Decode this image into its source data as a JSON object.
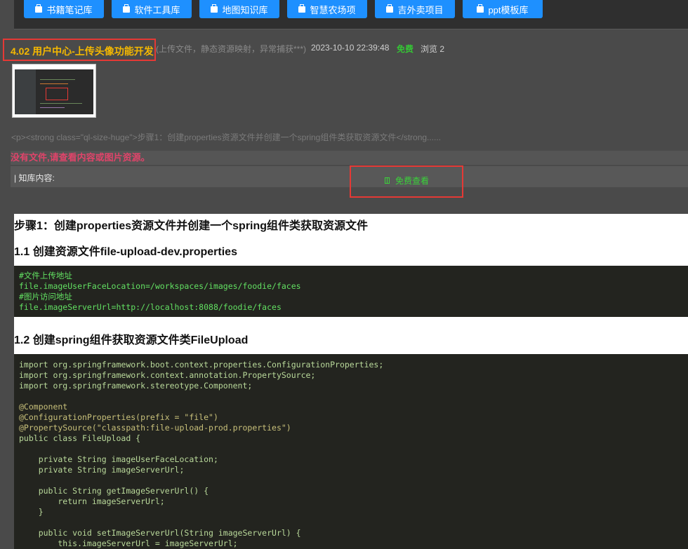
{
  "nav": {
    "buttons": [
      {
        "label": "书籍笔记库"
      },
      {
        "label": "软件工具库"
      },
      {
        "label": "地图知识库"
      },
      {
        "label": "智慧农场项"
      },
      {
        "label": "吉外卖项目"
      },
      {
        "label": "ppt模板库"
      }
    ]
  },
  "article": {
    "title": "4.02 用户中心-上传头像功能开发",
    "subtitle": "(上传文件，静态资源映射，异常捕获***)",
    "date": "2023-10-10 22:39:48",
    "price": "免费",
    "views": "浏览 2",
    "excerpt": "<p><strong class=\"ql-size-huge\">步骤1：创建properties资源文件并创建一个spring组件类获取资源文件</strong......",
    "no_file_notice": "没有文件,请查看内容或图片资源。",
    "kb_label": "| 知库内容:",
    "view_button": "免费查看"
  },
  "content": {
    "step1": "步骤1：创建properties资源文件并创建一个spring组件类获取资源文件",
    "h_1_1": "1.1 创建资源文件file-upload-dev.properties",
    "code1": [
      "#文件上传地址",
      "file.imageUserFaceLocation=/workspaces/images/foodie/faces",
      "#图片访问地址",
      "file.imageServerUrl=http://localhost:8088/foodie/faces"
    ],
    "h_1_2": "1.2 创建spring组件获取资源文件类FileUpload",
    "code2": [
      "import org.springframework.boot.context.properties.ConfigurationProperties;",
      "import org.springframework.context.annotation.PropertySource;",
      "import org.springframework.stereotype.Component;",
      "",
      "@Component",
      "@ConfigurationProperties(prefix = \"file\")",
      "@PropertySource(\"classpath:file-upload-prod.properties\")",
      "public class FileUpload {",
      "",
      "    private String imageUserFaceLocation;",
      "    private String imageServerUrl;",
      "",
      "    public String getImageServerUrl() {",
      "        return imageServerUrl;",
      "    }",
      "",
      "    public void setImageServerUrl(String imageServerUrl) {",
      "        this.imageServerUrl = imageServerUrl;"
    ]
  },
  "colors": {
    "nav_button": "#1e90ff",
    "title": "#f5b800",
    "free": "#35c435",
    "notice": "#e0446a",
    "highlight_box": "#e53935"
  }
}
